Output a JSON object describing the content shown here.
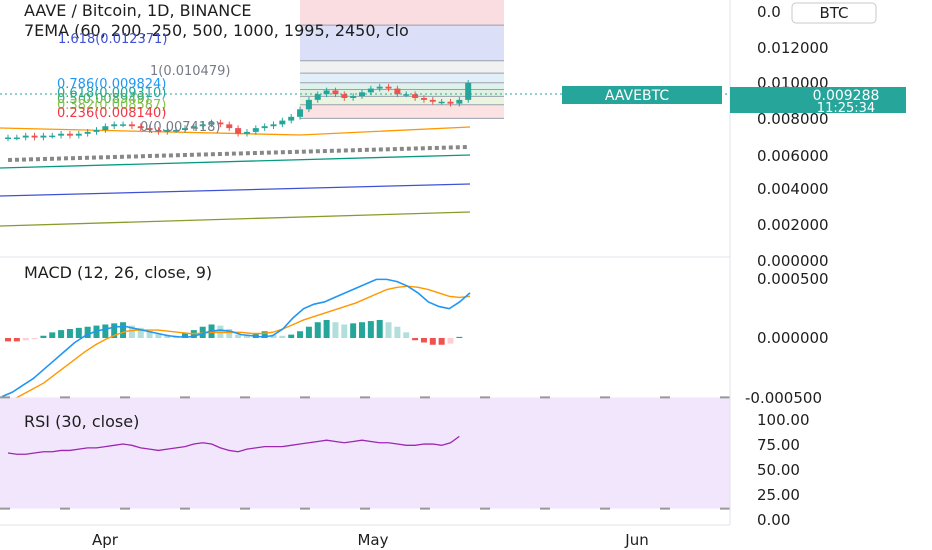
{
  "header": {
    "title": "AAVE / Bitcoin, 1D, BINANCE",
    "ema_label": "7EMA (60, 200, 250, 500, 1000, 1995, 2450, clo"
  },
  "currency_badge": "BTC",
  "price_label": {
    "symbol": "AAVEBTC",
    "price": "0.009288",
    "countdown": "11:25:34",
    "color": "#26a69a"
  },
  "fib_levels": [
    {
      "text": "1.618(0.012371)",
      "color": "#3f51d6"
    },
    {
      "text": "1(0.010479)",
      "color": "#787b86"
    },
    {
      "text": "0.786(0.009824)",
      "color": "#2196f3"
    },
    {
      "text": "0.618(0.009310)",
      "color": "#26a69a"
    },
    {
      "text": "0.5(0.008949)",
      "color": "#4caf50"
    },
    {
      "text": "0.382(0.008587)",
      "color": "#8bc34a"
    },
    {
      "text": "0.236(0.008140)",
      "color": "#f23645"
    },
    {
      "text": "0(0.007418)",
      "color": "#787b86"
    }
  ],
  "colors": {
    "up": "#26a69a",
    "down": "#ef5350",
    "macd": "#2196f3",
    "signal": "#ff9800",
    "rsi": "#9c27b0",
    "rsi_band": "#f2e6fd"
  },
  "chart_data": [
    {
      "type": "candlestick",
      "title": "AAVE / Bitcoin, 1D, BINANCE",
      "yticks": [
        "0.0",
        "0.012000",
        "0.010000",
        "0.008000",
        "0.006000",
        "0.004000",
        "0.002000",
        "0.000000"
      ],
      "ylim": [
        0,
        0.0135
      ],
      "close_approx": [
        0.0064,
        0.0064,
        0.0065,
        0.0064,
        0.0065,
        0.0065,
        0.0066,
        0.0065,
        0.0066,
        0.0067,
        0.0068,
        0.007,
        0.0071,
        0.0071,
        0.007,
        0.0069,
        0.0068,
        0.0067,
        0.0068,
        0.0068,
        0.0069,
        0.007,
        0.0071,
        0.0072,
        0.0071,
        0.0069,
        0.0066,
        0.0067,
        0.0069,
        0.007,
        0.0071,
        0.0073,
        0.0075,
        0.0079,
        0.0084,
        0.0087,
        0.0089,
        0.0087,
        0.0085,
        0.0086,
        0.0088,
        0.009,
        0.0091,
        0.009,
        0.0087,
        0.0087,
        0.0085,
        0.0084,
        0.0083,
        0.0083,
        0.0082,
        0.0084,
        0.0093
      ],
      "current_price": 0.009288
    },
    {
      "type": "bar",
      "title": "MACD (12, 26, close, 9)",
      "yticks": [
        "0.000500",
        "0.000000",
        "-0.000500"
      ],
      "ylim": [
        -0.0006,
        0.00055
      ],
      "histogram_approx": [
        -3e-05,
        -3e-05,
        -2e-05,
        -1e-05,
        2e-05,
        5e-05,
        7e-05,
        8e-05,
        9e-05,
        0.0001,
        0.00011,
        0.00012,
        0.00013,
        0.00014,
        0.00011,
        9e-05,
        6e-05,
        4e-05,
        3e-05,
        2e-05,
        4e-05,
        7e-05,
        0.0001,
        0.00012,
        0.00011,
        8e-05,
        3e-05,
        2e-05,
        4e-05,
        6e-05,
        3e-05,
        2e-05,
        3e-05,
        6e-05,
        0.0001,
        0.00014,
        0.00016,
        0.00014,
        0.00012,
        0.00013,
        0.00014,
        0.00015,
        0.00016,
        0.00014,
        0.0001,
        5e-05,
        -2e-05,
        -4e-05,
        -6e-05,
        -6e-05,
        -5e-05,
        1e-05
      ],
      "macd_approx": [
        -0.00052,
        -0.00048,
        -0.00042,
        -0.00036,
        -0.00028,
        -0.0002,
        -0.00012,
        -4e-05,
        2e-05,
        6e-05,
        8e-05,
        0.0001,
        0.0001,
        8e-05,
        6e-05,
        4e-05,
        2e-05,
        1e-05,
        1e-05,
        3e-05,
        6e-05,
        7e-05,
        6e-05,
        3e-05,
        2e-05,
        1e-05,
        2e-05,
        8e-05,
        0.00018,
        0.00026,
        0.0003,
        0.00032,
        0.00036,
        0.0004,
        0.00044,
        0.00048,
        0.00052,
        0.00052,
        0.0005,
        0.00046,
        0.0004,
        0.00032,
        0.00028,
        0.00026,
        0.00032,
        0.0004
      ],
      "signal_approx": [
        -0.00058,
        -0.00055,
        -0.0005,
        -0.00045,
        -0.0004,
        -0.00033,
        -0.00026,
        -0.00019,
        -0.00012,
        -6e-05,
        -1e-05,
        3e-05,
        6e-05,
        7e-05,
        7e-05,
        7e-05,
        6e-05,
        5e-05,
        4e-05,
        4e-05,
        5e-05,
        5e-05,
        5e-05,
        5e-05,
        4e-05,
        4e-05,
        5e-05,
        8e-05,
        0.00012,
        0.00016,
        0.00019,
        0.00022,
        0.00025,
        0.00028,
        0.00031,
        0.00035,
        0.00039,
        0.00043,
        0.00045,
        0.00046,
        0.00045,
        0.00043,
        0.0004,
        0.00037,
        0.00036,
        0.00037
      ]
    },
    {
      "type": "line",
      "title": "RSI (30, close)",
      "yticks": [
        "100.00",
        "75.00",
        "50.00",
        "25.00",
        "0.00"
      ],
      "ylim": [
        0,
        100
      ],
      "band": [
        70,
        30
      ],
      "values_approx": [
        50,
        49,
        49,
        50,
        51,
        51,
        52,
        52,
        53,
        54,
        54,
        55,
        56,
        57,
        56,
        54,
        53,
        52,
        53,
        54,
        55,
        57,
        58,
        57,
        54,
        52,
        51,
        53,
        54,
        55,
        55,
        55,
        56,
        57,
        58,
        59,
        60,
        59,
        58,
        59,
        60,
        59,
        58,
        58,
        57,
        56,
        56,
        57,
        57,
        56,
        58,
        63
      ]
    }
  ],
  "x_axis_labels": [
    "Apr",
    "May",
    "Jun"
  ]
}
